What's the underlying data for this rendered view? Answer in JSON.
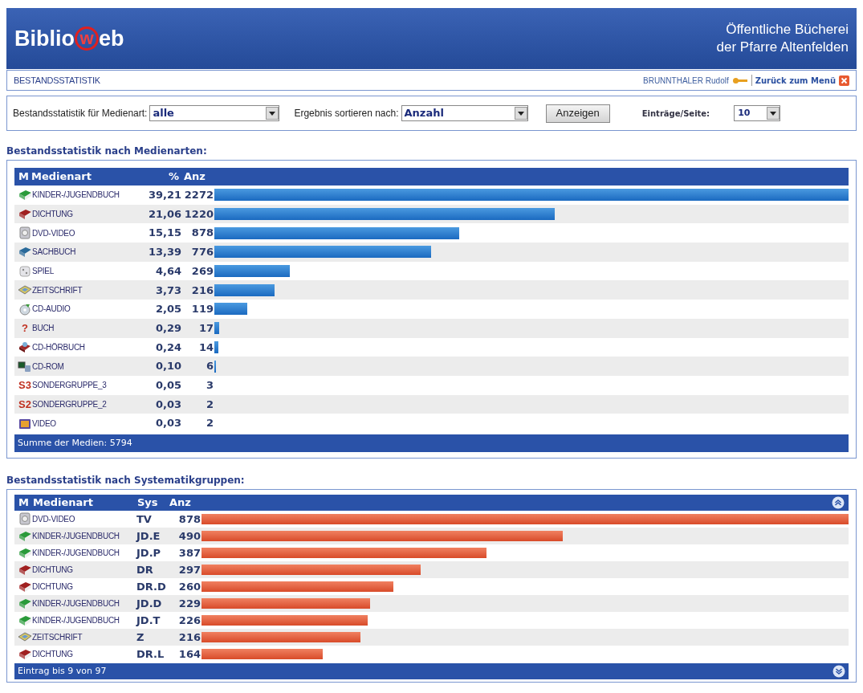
{
  "header": {
    "logo_left": "Biblio",
    "logo_circle": "w",
    "logo_right": "eb",
    "library": [
      "Öffentliche Bücherei",
      "der Pfarre Altenfelden"
    ]
  },
  "nav": {
    "title": "BESTANDSSTATISTIK",
    "user": "BRUNNTHALER Rudolf",
    "back_link": "Zurück zum Menü"
  },
  "filters": {
    "medienart_label": "Bestandsstatistik für Medienart:",
    "medienart_value": "alle",
    "sort_label": "Ergebnis sortieren nach:",
    "sort_value": "Anzahl",
    "show_button": "Anzeigen",
    "per_page_label": "Einträge/Seite:",
    "per_page_value": "10"
  },
  "media_table": {
    "title": "Bestandsstatistik nach Medienarten:",
    "columns": [
      "M",
      "Medienart",
      "%",
      "Anz"
    ],
    "rows": [
      {
        "kind": "green-book",
        "name": "KINDER-/JUGENDBUCH",
        "percent": "39,21",
        "count": "2272"
      },
      {
        "kind": "red-book",
        "name": "DICHTUNG",
        "percent": "21,06",
        "count": "1220"
      },
      {
        "kind": "disc-case",
        "name": "DVD-VIDEO",
        "percent": "15,15",
        "count": "878"
      },
      {
        "kind": "blue-book",
        "name": "SACHBUCH",
        "percent": "13,39",
        "count": "776"
      },
      {
        "kind": "dice",
        "name": "SPIEL",
        "percent": "4,64",
        "count": "269"
      },
      {
        "kind": "magazine",
        "name": "ZEITSCHRIFT",
        "percent": "3,73",
        "count": "216"
      },
      {
        "kind": "cd",
        "name": "CD-AUDIO",
        "percent": "2,05",
        "count": "119"
      },
      {
        "kind": "glyph",
        "icon_text": "?",
        "name": "BUCH",
        "percent": "0,29",
        "count": "17"
      },
      {
        "kind": "cd-book",
        "name": "CD-HÖRBUCH",
        "percent": "0,24",
        "count": "14"
      },
      {
        "kind": "computer",
        "name": "CD-ROM",
        "percent": "0,10",
        "count": "6"
      },
      {
        "kind": "glyph",
        "icon_text": "S3",
        "name": "SONDERGRUPPE_3",
        "percent": "0,05",
        "count": "3"
      },
      {
        "kind": "glyph",
        "icon_text": "S2",
        "name": "SONDERGRUPPE_2",
        "percent": "0,03",
        "count": "2"
      },
      {
        "kind": "tv",
        "name": "VIDEO",
        "percent": "0,03",
        "count": "2"
      }
    ],
    "footer": "Summe der Medien: 5794"
  },
  "sys_table": {
    "title": "Bestandsstatistik nach Systematikgruppen:",
    "columns": [
      "M",
      "Medienart",
      "Sys",
      "Anz"
    ],
    "rows": [
      {
        "kind": "disc-case",
        "name": "DVD-VIDEO",
        "sys": "TV",
        "count": "878"
      },
      {
        "kind": "green-book",
        "name": "KINDER-/JUGENDBUCH",
        "sys": "JD.E",
        "count": "490"
      },
      {
        "kind": "green-book",
        "name": "KINDER-/JUGENDBUCH",
        "sys": "JD.P",
        "count": "387"
      },
      {
        "kind": "red-book",
        "name": "DICHTUNG",
        "sys": "DR",
        "count": "297"
      },
      {
        "kind": "red-book",
        "name": "DICHTUNG",
        "sys": "DR.D",
        "count": "260"
      },
      {
        "kind": "green-book",
        "name": "KINDER-/JUGENDBUCH",
        "sys": "JD.D",
        "count": "229"
      },
      {
        "kind": "green-book",
        "name": "KINDER-/JUGENDBUCH",
        "sys": "JD.T",
        "count": "226"
      },
      {
        "kind": "magazine",
        "name": "ZEITSCHRIFT",
        "sys": "Z",
        "count": "216"
      },
      {
        "kind": "red-book",
        "name": "DICHTUNG",
        "sys": "DR.L",
        "count": "164"
      }
    ],
    "footer": "Eintrag bis 9 von 97"
  }
}
